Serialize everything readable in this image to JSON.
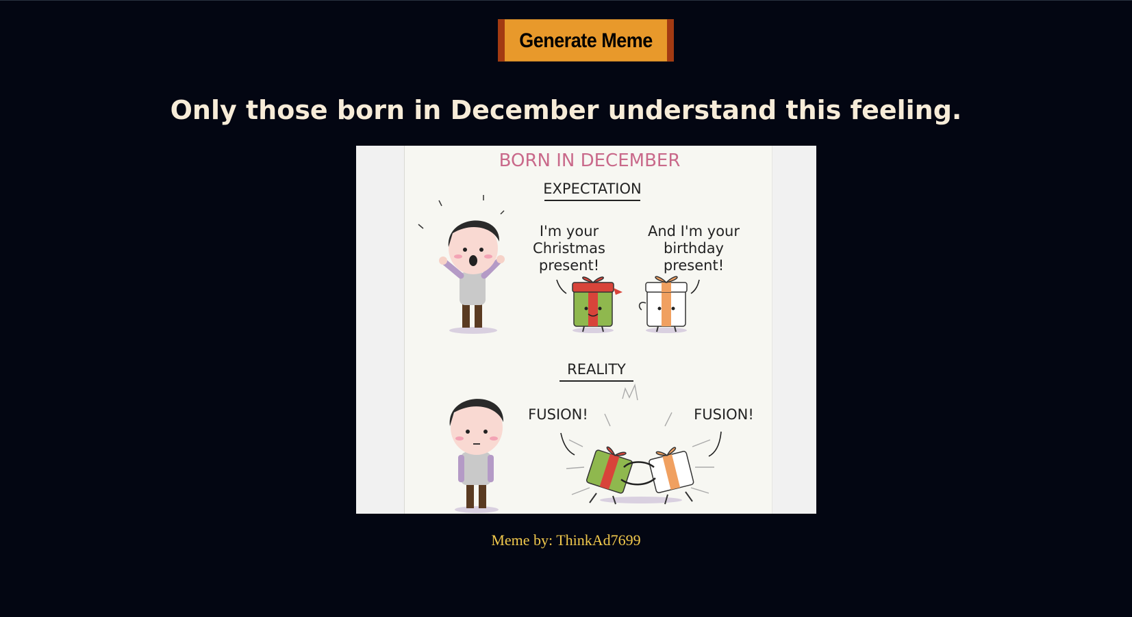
{
  "button": {
    "generate_label": "Generate Meme"
  },
  "meme": {
    "title": "Only those born in December understand this feeling.",
    "comic": {
      "heading": "BORN IN DECEMBER",
      "expectation_label": "EXPECTATION",
      "christmas_line1": "I'm your",
      "christmas_line2": "Christmas",
      "christmas_line3": "present!",
      "birthday_line1": "And I'm your",
      "birthday_line2": "birthday",
      "birthday_line3": "present!",
      "reality_label": "REALITY",
      "fusion_left": "FUSION!",
      "fusion_right": "FUSION!"
    },
    "credit": "Meme by: ThinkAd7699"
  },
  "colors": {
    "background": "#030612",
    "button": "#e8992b",
    "button_border": "#a33a12",
    "title": "#f7ecd8",
    "credit": "#f2c94c"
  }
}
